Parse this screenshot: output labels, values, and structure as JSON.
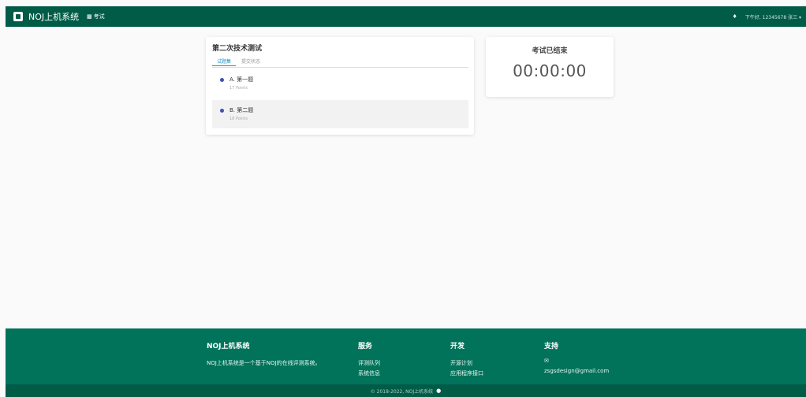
{
  "navbar": {
    "brand": "NOJ上机系统",
    "exam_link": "考试",
    "user_info": "下午好, 12345678 张三 ▾"
  },
  "problem_card": {
    "title": "第二次技术测试",
    "tabs": [
      {
        "label": "试题集",
        "active": true
      },
      {
        "label": "提交状态",
        "active": false
      }
    ],
    "problems": [
      {
        "title": "A. 第一题",
        "points": "17 Points"
      },
      {
        "title": "B. 第二题",
        "points": "18 Points"
      }
    ]
  },
  "timer_card": {
    "title": "考试已结束",
    "value": "00:00:00"
  },
  "footer": {
    "about": {
      "heading": "NOJ上机系统",
      "text": "NOJ上机系统是一个基于NOJ的在线评测系统。"
    },
    "services": {
      "heading": "服务",
      "items": [
        "评测队列",
        "系统信息"
      ]
    },
    "develop": {
      "heading": "开发",
      "items": [
        "开源计划",
        "应用程序接口"
      ]
    },
    "support": {
      "heading": "支持",
      "email": "zsgsdesign@gmail.com"
    },
    "copyright": "© 2018-2022, NOJ上机系统"
  },
  "colors": {
    "navbar": "#005b47",
    "footer": "#00735a",
    "accent": "#2196c4",
    "dot": "#3f51b5"
  }
}
